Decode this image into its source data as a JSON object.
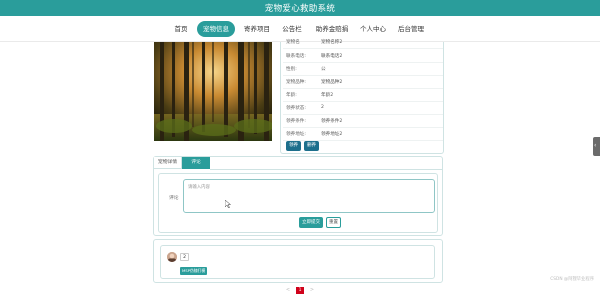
{
  "header": {
    "title": "宠物爱心救助系统"
  },
  "nav": {
    "items": [
      {
        "label": "首页",
        "active": false
      },
      {
        "label": "宠物信息",
        "active": true
      },
      {
        "label": "寄养项目",
        "active": false
      },
      {
        "label": "公告栏",
        "active": false
      },
      {
        "label": "助养金赔捐",
        "active": false
      },
      {
        "label": "个人中心",
        "active": false
      },
      {
        "label": "后台管理",
        "active": false
      }
    ]
  },
  "info": {
    "rows": [
      {
        "label": "宠物名",
        "value": "宠物名称2"
      },
      {
        "label": "联系电话:",
        "value": "联系电话2"
      },
      {
        "label": "性别:",
        "value": "公"
      },
      {
        "label": "宠物品种:",
        "value": "宠物品种2"
      },
      {
        "label": "年龄:",
        "value": "年龄2"
      },
      {
        "label": "领养状态:",
        "value": "2"
      },
      {
        "label": "领养条件:",
        "value": "领养条件2"
      },
      {
        "label": "领养地址:",
        "value": "领养地址2"
      }
    ],
    "buttons": {
      "adopt": "领养",
      "delete": "删养"
    }
  },
  "tabs": {
    "detail": "宠物详情",
    "comment": "评论"
  },
  "comment": {
    "label": "评论",
    "placeholder": "请输入内容",
    "submit": "立即提交",
    "reset": "重置"
  },
  "reviews": [
    {
      "name": "2",
      "tag": "MSP伪随打模"
    }
  ],
  "pager": {
    "current": "1",
    "prev": "<",
    "next": ">"
  },
  "watermark": "CSDN @阿狸毕业程序",
  "colors": {
    "primary": "#2a9d9b",
    "dark_button": "#1d6f8c",
    "pager_active": "#d0021b"
  },
  "icons": {
    "side_handle": "chevron-left-icon"
  }
}
